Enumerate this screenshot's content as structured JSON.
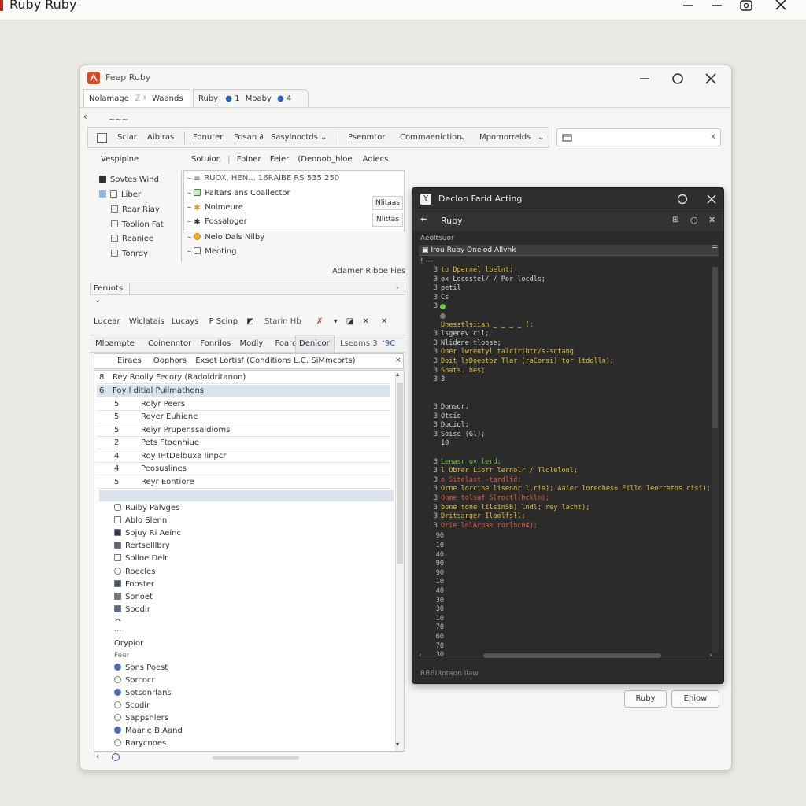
{
  "outer": {
    "title": "Ruby Ruby"
  },
  "main": {
    "title": "Feep Ruby",
    "tabs": [
      {
        "label": "Nolamage",
        "badge": "ℤ ˠ"
      },
      {
        "label": "Waands"
      },
      {
        "label": "Ruby"
      },
      {
        "label": "1"
      },
      {
        "label": "Moaby"
      },
      {
        "label": "4"
      }
    ],
    "back": "‹",
    "squiggle": "~~~",
    "toolbar": [
      "Sciar",
      "Aibiras",
      "Fonuter",
      "Fosan ∂",
      "Sasylnoctds ⌄",
      "Psenmtor",
      "Commaeniction",
      "Mpomorrelds"
    ],
    "sidebar_header": "Vespipine",
    "sidebar": [
      "Sovtes Wind",
      "Liber",
      "Roar Riay",
      "Toolion Fat",
      "Reaniee",
      "Tonrdy"
    ],
    "columns": [
      "Sotuion",
      "Folner",
      "Feier",
      "(Deonob_hloe",
      "Adiecs"
    ],
    "file_rows": [
      "RUOX, HEN... 16RAIBE RS 535 250",
      "Paltars ans Coallector",
      "Nolmeure",
      "Fossaloger",
      "Nelo Dals Nilby",
      "Meoting"
    ],
    "side_buttons": [
      "Nlitaas",
      "Nlittas"
    ],
    "right_caption": "Adamer Ribbe Fies",
    "section_label": "Feruots",
    "lower_toolbar": [
      "Lucear",
      "Wiclatais",
      "Lucays",
      "Scinp",
      "Starin Hb"
    ],
    "lower_tabs": [
      "Mloampte",
      "Coinenntor",
      "Fonrilos",
      "Modly",
      "Foarots",
      "Denicor",
      "Lseams 3",
      "ᐩ9C"
    ],
    "inner_bar": [
      "Eiraes",
      "Oophors",
      "Exset Lortisf (Conditions L.C. SiMmcorts)"
    ],
    "list_rows": [
      {
        "num": "8",
        "label": "Rey Roolly Fecory (Radoldritanon)"
      },
      {
        "num": "6",
        "label": "Foy l ditial Puilmathons"
      },
      {
        "num": "5",
        "label": "Rolyr Peers"
      },
      {
        "num": "5",
        "label": "Reyer Euhiene"
      },
      {
        "num": "5",
        "label": "Reiyr Prupenssaldioms"
      },
      {
        "num": "2",
        "label": "Pets Ftoenhiue"
      },
      {
        "num": "4",
        "label": "Roy IHtDelbuxa linpcr"
      },
      {
        "num": "4",
        "label": "Peosuslines"
      },
      {
        "num": "5",
        "label": "Reyr Eontiore"
      }
    ],
    "group_items": [
      "Ruiby Palvges",
      "Ablo Slenn",
      "Sojuy Ri Aeinc",
      "Rertselllbry",
      "Solloe Delr",
      "Roecles",
      "Fooster",
      "Sonoet",
      "Soodir"
    ],
    "group_label": "Orypior",
    "group_sub": "Feer",
    "group2_items": [
      "Sons Poest",
      "Sorcocr",
      "Sotsonrlans",
      "Scodir",
      "Sappsnlers",
      "Maarie B.Aand",
      "Rarycnoes"
    ],
    "buttons": {
      "ruby": "Ruby",
      "ehiow": "Ehiow"
    }
  },
  "editor": {
    "title": "Declon Farid Acting",
    "sub_title": "Ruby",
    "section": "Aeoltsuor",
    "header_row": "Irou Ruby Onelod Allvnk",
    "status": "RBBIRotaon Ilaw",
    "code_lines": [
      {
        "ln": "3",
        "text": "to Dpernel lbelnt;",
        "color": "#e0c030"
      },
      {
        "ln": "3",
        "text": "ox Lecostel/ / Por locdls;",
        "color": "#d4d4d4"
      },
      {
        "ln": "3",
        "text": "petil",
        "color": "#d4d4d4"
      },
      {
        "ln": "3",
        "text": "Cs",
        "color": "#d4d4d4"
      },
      {
        "ln": "3",
        "text": "",
        "color": "#d4d4d4"
      },
      {
        "ln": "",
        "text": "",
        "color": "#d4d4d4"
      },
      {
        "ln": "",
        "text": "Unesstlsiian ‿ ‿ ‿ ‿ (;",
        "color": "#e0c030"
      },
      {
        "ln": "3",
        "text": "lsgenev.cil;",
        "color": "#d4d4d4"
      },
      {
        "ln": "3",
        "text": "Nlidene tloose;",
        "color": "#d4d4d4"
      },
      {
        "ln": "3",
        "text": "Oner lwrentyl talciribtr/s-sctang",
        "color": "#e0c030"
      },
      {
        "ln": "3",
        "text": "Doit lsDoeotoz Tlar (raCorsi) tor ltddlln);",
        "color": "#e0c030"
      },
      {
        "ln": "3",
        "text": "Soats. hes;",
        "color": "#e0c030"
      },
      {
        "ln": "3",
        "text": "3",
        "color": "#d4d4d4"
      },
      {
        "ln": "",
        "text": "",
        "color": "#d4d4d4"
      },
      {
        "ln": "",
        "text": "",
        "color": "#d4d4d4"
      },
      {
        "ln": "3",
        "text": "Donsor,",
        "color": "#d4d4d4"
      },
      {
        "ln": "3",
        "text": "Otsie",
        "color": "#d4d4d4"
      },
      {
        "ln": "3",
        "text": "Dociol;",
        "color": "#d4d4d4"
      },
      {
        "ln": "3",
        "text": "Soise (Gl);",
        "color": "#d4d4d4"
      },
      {
        "ln": "",
        "text": "10",
        "color": "#d4d4d4"
      },
      {
        "ln": "",
        "text": "",
        "color": "#d4d4d4"
      },
      {
        "ln": "3",
        "text": "Lenasr ov lerd;",
        "color": "#6ccc3c"
      },
      {
        "ln": "3",
        "text": "l Obrer Liorr lernolr / Tlclelonl;",
        "color": "#e0c030"
      },
      {
        "ln": "3",
        "text": "o  Sitelast  -tardlfd;",
        "color": "#e05a3a"
      },
      {
        "ln": "3",
        "text": "Orne lorcine lisenor l,ris); Aaier loreohes= Eillo leorretos cisi);",
        "color": "#e0c030"
      },
      {
        "ln": "3",
        "text": "Oome tolsaf Slroctl(hckln);",
        "color": "#e05a3a"
      },
      {
        "ln": "3",
        "text": "bone tone lilsinSB) lndl;  rey lacht);",
        "color": "#e0c030"
      },
      {
        "ln": "3",
        "text": "Dritsarger Iloolfsll;",
        "color": "#e0c030"
      },
      {
        "ln": "3",
        "text": "Orie lnlArpae  rorloc04);",
        "color": "#e05a3a"
      }
    ],
    "trailing_numbers": [
      "90",
      "10",
      "40",
      "90",
      "90",
      "10",
      "40",
      "30",
      "30",
      "10",
      "70",
      "60",
      "70",
      "30"
    ]
  },
  "colors": {
    "accent": "#c02a1a",
    "editor_bg": "#2b2b2b"
  }
}
